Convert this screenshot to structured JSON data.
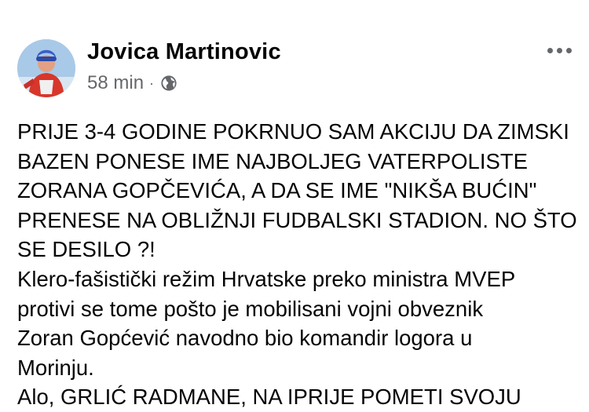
{
  "post": {
    "author": "Jovica Martinovic",
    "time": "58 min",
    "separator": "·",
    "audience_icon": "globe-icon",
    "more_icon": "more-options-icon",
    "lines": [
      "PRIJE 3-4 GODINE POKRNUO SAM AKCIJU DA ZIMSKI",
      "BAZEN PONESE IME NAJBOLJEG VATERPOLISTE",
      "ZORANA GOPČEVIĆA, A DA SE IME \"NIKŠA BUĆIN\"",
      "PRENESE NA OBLIŽNJI FUDBALSKI STADION. NO ŠTO",
      "SE DESILO ?!",
      "Klero-fašistički režim Hrvatske preko ministra MVEP",
      "protivi se tome pošto je mobilisani vojni obveznik",
      "Zoran Gopćević navodno bio komandir logora u",
      "Morinju.",
      "Alo, GRLIĆ RADMANE, NA IPRIJE POMETI SVOJU"
    ]
  },
  "colors": {
    "text": "#050505",
    "secondary": "#65676b",
    "background": "#ffffff"
  }
}
